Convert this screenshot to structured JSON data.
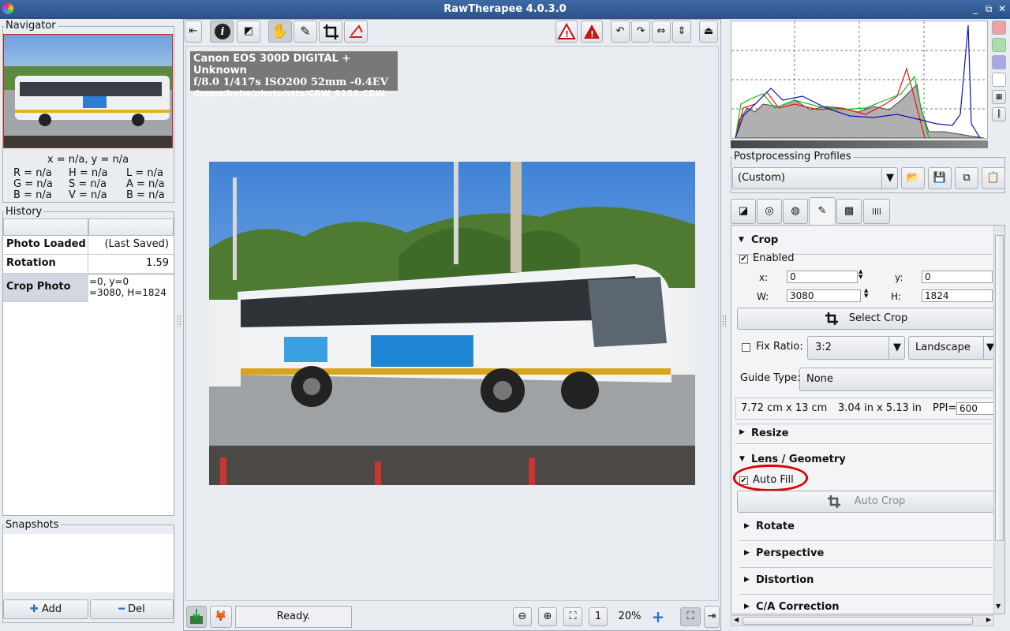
{
  "window": {
    "title": "RawTherapee 4.0.3.0",
    "controls": [
      "_",
      "⧉",
      "✕"
    ]
  },
  "navigator": {
    "label": "Navigator",
    "coords": "x = n/a, y = n/a",
    "values": [
      [
        "R = n/a",
        "H = n/a",
        "L = n/a"
      ],
      [
        "G = n/a",
        "S = n/a",
        "A = n/a"
      ],
      [
        "B = n/a",
        "V = n/a",
        "B = n/a"
      ]
    ]
  },
  "history": {
    "label": "History",
    "rows": [
      {
        "name": "Photo Loaded",
        "value": "(Last Saved)"
      },
      {
        "name": "Rotation",
        "value": "1.59"
      },
      {
        "name": "Crop Photo",
        "value1": "=0, y=0",
        "value2": "=3080, H=1824"
      }
    ]
  },
  "snapshots": {
    "label": "Snapshots",
    "add": "Add",
    "del": "Del"
  },
  "info": {
    "camera": "Canon EOS 300D DIGITAL + Unknown",
    "exposure": "f/8.0  1/417s  ISO200  52mm  -0.4EV",
    "path": "/home/buba/photo/stts/CRW_9159.CRW"
  },
  "statusbar": {
    "status": "Ready.",
    "zoom": "20%"
  },
  "profiles": {
    "label": "Postprocessing Profiles",
    "selected": "(Custom)"
  },
  "crop": {
    "title": "Crop",
    "enabled_label": "Enabled",
    "enabled": true,
    "x_label": "x:",
    "x": "0",
    "y_label": "y:",
    "y": "0",
    "w_label": "W:",
    "w": "3080",
    "h_label": "H:",
    "h": "1824",
    "select_crop": "Select Crop",
    "fix_ratio_label": "Fix Ratio:",
    "ratio": "3:2",
    "orientation": "Landscape",
    "guide_label": "Guide Type:",
    "guide": "None",
    "size_cm": "7.72 cm x 13 cm",
    "size_in": "3.04 in x 5.13 in",
    "ppi_label": "PPI=",
    "ppi": "600"
  },
  "sections": {
    "resize": "Resize",
    "lens": "Lens / Geometry",
    "auto_fill": "Auto Fill",
    "auto_crop": "Auto Crop",
    "rotate": "Rotate",
    "perspective": "Perspective",
    "distortion": "Distortion",
    "ca": "C/A Correction"
  },
  "colors": {
    "title_bar": "#3f6aa5",
    "annotation": "#e00000",
    "accent": "#2f6fc9"
  }
}
